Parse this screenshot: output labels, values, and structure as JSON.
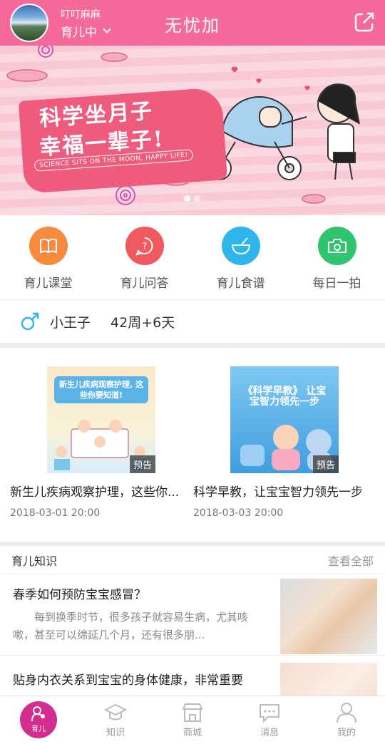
{
  "header": {
    "user_name": "叮叮麻麻",
    "user_status": "育儿中",
    "app_title": "无忧加",
    "icons": {
      "avatar": "avatar",
      "status_dropdown": "chevron-down-icon",
      "share": "share-icon"
    }
  },
  "banner": {
    "line1": "科学坐月子",
    "line2": "幸福一辈子!",
    "subtitle": "SCIENCE SITS ON THE MOON, HAPPY LIFE!",
    "page_count": 2,
    "active_page": 1
  },
  "quick_menu": [
    {
      "label": "育儿课堂",
      "icon": "book-icon",
      "color": "#f78a3c"
    },
    {
      "label": "育儿问答",
      "icon": "question-icon",
      "color": "#f05a5e"
    },
    {
      "label": "育儿食谱",
      "icon": "bowl-icon",
      "color": "#2db5ec"
    },
    {
      "label": "每日一拍",
      "icon": "camera-icon",
      "color": "#2fc46e"
    }
  ],
  "baby": {
    "icon": "male-icon",
    "name": "小王子",
    "age": "42周+6天"
  },
  "courses": [
    {
      "thumb_text": "新生儿疾病观察护理, 这些你要知道!",
      "tag": "预告",
      "title": "新生儿疾病观察护理，这些你...",
      "date": "2018-03-01 20:00"
    },
    {
      "thumb_text": "《科学早教》 让宝宝智力领先一步",
      "tag": "预告",
      "title": "科学早教，让宝宝智力领先一步",
      "date": "2018-03-03 20:00"
    }
  ],
  "knowledge": {
    "title": "育儿知识",
    "more": "查看全部",
    "articles": [
      {
        "title": "春季如何预防宝宝感冒？",
        "excerpt": "每到换季时节，很多孩子就容易生病，尤其咳嗽，甚至可以绵延几个月，还有很多朋..."
      },
      {
        "title": "贴身内衣关系到宝宝的身体健康，非常重要",
        "excerpt": ""
      }
    ]
  },
  "bottom_nav": [
    {
      "label": "育儿",
      "icon": "mother-baby-icon",
      "active": true
    },
    {
      "label": "知识",
      "icon": "graduation-cap-icon",
      "active": false
    },
    {
      "label": "商城",
      "icon": "store-icon",
      "active": false
    },
    {
      "label": "消息",
      "icon": "message-icon",
      "active": false
    },
    {
      "label": "我的",
      "icon": "user-icon",
      "active": false
    }
  ],
  "colors": {
    "primary": "#f56a9b",
    "active_nav": "#d32e8f",
    "male": "#2db5ec"
  }
}
